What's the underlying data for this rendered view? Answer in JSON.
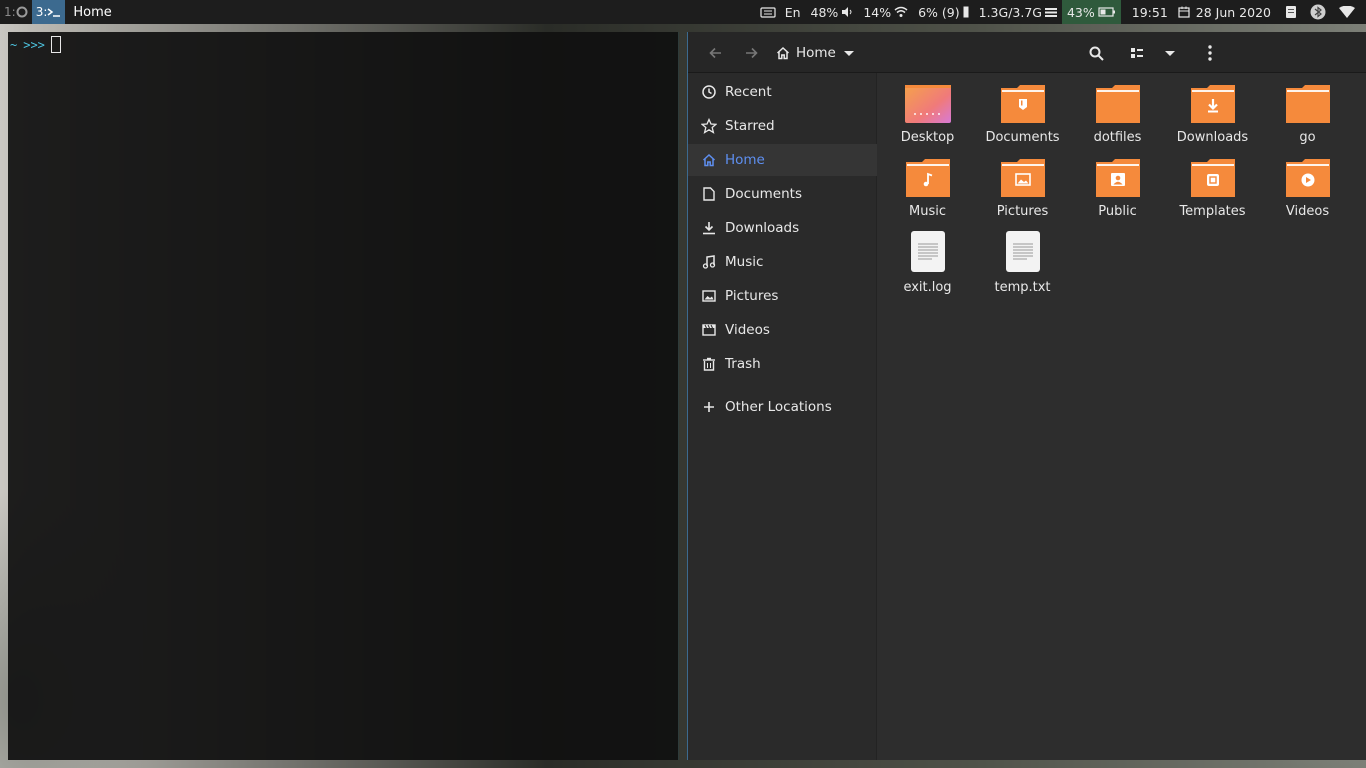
{
  "topbar": {
    "workspaces": [
      {
        "label": "1:",
        "icon": "firefox-icon"
      },
      {
        "label": "3:",
        "icon": "terminal-icon"
      }
    ],
    "window_title": "Home",
    "keyboard_layout": "En",
    "volume": "48%",
    "wifi_signal": "14%",
    "cpu": "6% (9)",
    "memory": "1.3G/3.7G",
    "battery": "43%",
    "time": "19:51",
    "date": "28 Jun 2020",
    "colors": {
      "active_workspace": "#3c6a8f",
      "battery_bg": "#2f5a3c"
    }
  },
  "terminal": {
    "prompt_dir": "~",
    "prompt_symbol": ">>>"
  },
  "file_manager": {
    "path_label": "Home",
    "sidebar": {
      "items": [
        {
          "label": "Recent",
          "icon": "clock-icon"
        },
        {
          "label": "Starred",
          "icon": "star-icon"
        },
        {
          "label": "Home",
          "icon": "home-icon",
          "active": true
        },
        {
          "label": "Documents",
          "icon": "document-icon"
        },
        {
          "label": "Downloads",
          "icon": "download-icon"
        },
        {
          "label": "Music",
          "icon": "music-icon"
        },
        {
          "label": "Pictures",
          "icon": "image-icon"
        },
        {
          "label": "Videos",
          "icon": "video-icon"
        },
        {
          "label": "Trash",
          "icon": "trash-icon"
        }
      ],
      "other_locations": "Other Locations"
    },
    "files": [
      {
        "name": "Desktop",
        "type": "desktop-folder"
      },
      {
        "name": "Documents",
        "type": "documents-folder"
      },
      {
        "name": "dotfiles",
        "type": "folder"
      },
      {
        "name": "Downloads",
        "type": "downloads-folder"
      },
      {
        "name": "go",
        "type": "folder"
      },
      {
        "name": "Music",
        "type": "music-folder"
      },
      {
        "name": "Pictures",
        "type": "pictures-folder"
      },
      {
        "name": "Public",
        "type": "public-folder"
      },
      {
        "name": "Templates",
        "type": "templates-folder"
      },
      {
        "name": "Videos",
        "type": "videos-folder"
      },
      {
        "name": "exit.log",
        "type": "text-file"
      },
      {
        "name": "temp.txt",
        "type": "text-file"
      }
    ],
    "colors": {
      "folder": "#f58a3c",
      "accent": "#5e8ff0"
    }
  }
}
